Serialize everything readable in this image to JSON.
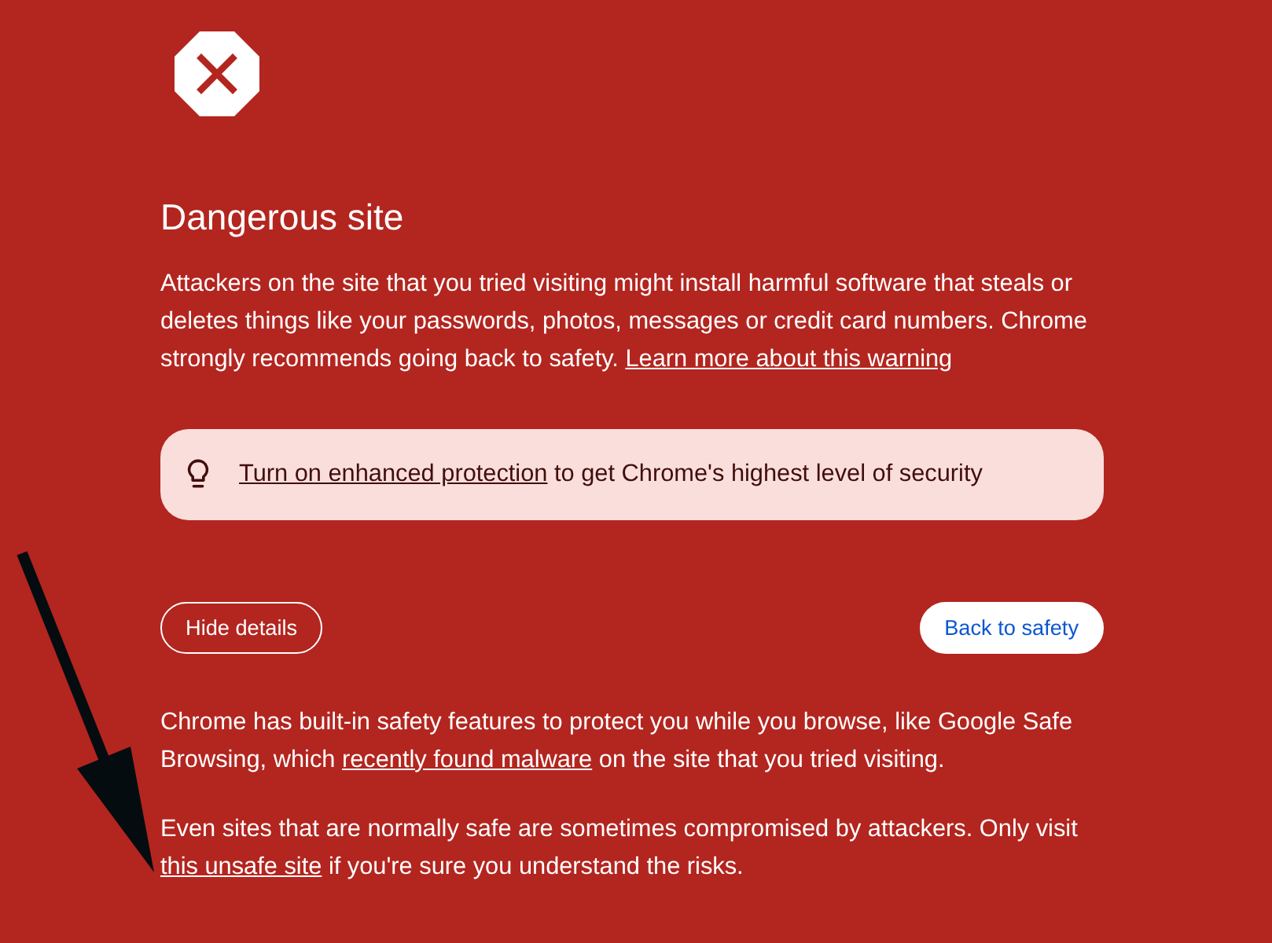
{
  "title": "Dangerous site",
  "description": [
    {
      "kind": "text",
      "text": "Attackers on the site that you tried visiting might install harmful software that steals or deletes things like your passwords, photos, messages or credit card numbers. Chrome strongly recommends going back to safety."
    },
    {
      "kind": "link",
      "text": "Learn more about this warning"
    }
  ],
  "promo": [
    {
      "kind": "link",
      "text": "Turn on enhanced protection"
    },
    {
      "kind": "text",
      "text": "to get Chrome's highest level of security"
    }
  ],
  "buttons": [
    {
      "label": "Hide details",
      "kind": "outline"
    },
    {
      "label": "Back to safety",
      "kind": "filled"
    }
  ],
  "details": [
    [
      {
        "kind": "text",
        "text": "Chrome has built-in safety features to protect you while you browse, like Google Safe Browsing, which"
      },
      {
        "kind": "link",
        "text": "recently found malware"
      },
      {
        "kind": "text",
        "text": "on the site that you tried visiting."
      }
    ],
    [
      {
        "kind": "text",
        "text": "Even sites that are normally safe are sometimes compromised by attackers. Only visit"
      },
      {
        "kind": "link",
        "text": "this unsafe site"
      },
      {
        "kind": "text",
        "text": "if you're sure you understand the risks."
      }
    ]
  ]
}
